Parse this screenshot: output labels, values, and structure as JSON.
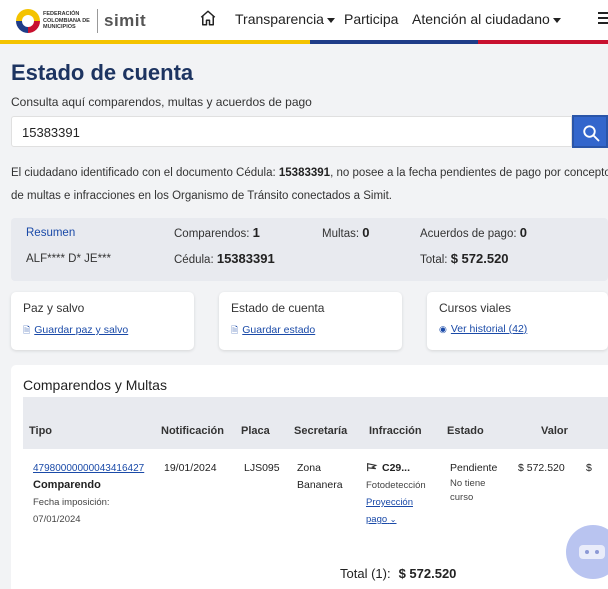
{
  "header": {
    "logo_text": "FEDERACIÓN COLOMBIANA DE MUNICIPIOS",
    "logo_brand": "simit",
    "nav": [
      {
        "label": "Transparencia",
        "dropdown": true
      },
      {
        "label": "Participa",
        "dropdown": false
      },
      {
        "label": "Atención al ciudadano",
        "dropdown": true
      }
    ],
    "stripe_colors": [
      "#f4c300",
      "#1f3c88",
      "#c8102e"
    ]
  },
  "page": {
    "title": "Estado de cuenta",
    "subtitle": "Consulta aquí comparendos, multas y acuerdos de pago",
    "search_value": "15383391"
  },
  "info": {
    "prefix": "El ciudadano identificado con el documento ",
    "doc_type": "Cédula: ",
    "doc_number": "15383391",
    "suffix": ", no posee a la fecha pendientes de pago por concepto de multas e infracciones en los Organismo de Tránsito conectados a Simit."
  },
  "summary": {
    "resumen_label": "Resumen",
    "name": "ALF**** D* JE***",
    "comparendos_label": "Comparendos:",
    "comparendos_value": "1",
    "multas_label": "Multas:",
    "multas_value": "0",
    "acuerdos_label": "Acuerdos de pago:",
    "acuerdos_value": "0",
    "cedula_label": "Cédula:",
    "cedula_value": "15383391",
    "total_label": "Total:",
    "total_value": "$ 572.520"
  },
  "cards": [
    {
      "title": "Paz y salvo",
      "link": "Guardar paz y salvo",
      "icon": "document-icon"
    },
    {
      "title": "Estado de cuenta",
      "link": "Guardar estado",
      "icon": "document-icon"
    },
    {
      "title": "Cursos viales",
      "link": "Ver historial (42)",
      "icon": "eye-icon"
    }
  ],
  "table": {
    "title": "Comparendos y Multas",
    "headers": [
      "Tipo",
      "Notificación",
      "Placa",
      "Secretaría",
      "Infracción",
      "Estado",
      "Valor"
    ],
    "rows": [
      {
        "numero": "47980000000043416427",
        "tipo": "Comparendo",
        "fecha_label": "Fecha imposición:",
        "fecha": "07/01/2024",
        "notificacion": "19/01/2024",
        "placa": "LJS095",
        "secretaria": "Zona Bananera",
        "infraccion_codigo": "C29...",
        "infraccion_tipo": "Fotodetección",
        "proyeccion_link": "Proyección pago",
        "estado": "Pendiente",
        "estado_detalle": "No tiene curso",
        "valor": "$ 572.520",
        "valor_extra": "$"
      }
    ],
    "total_label": "Total (1):",
    "total_value": "$ 572.520"
  }
}
